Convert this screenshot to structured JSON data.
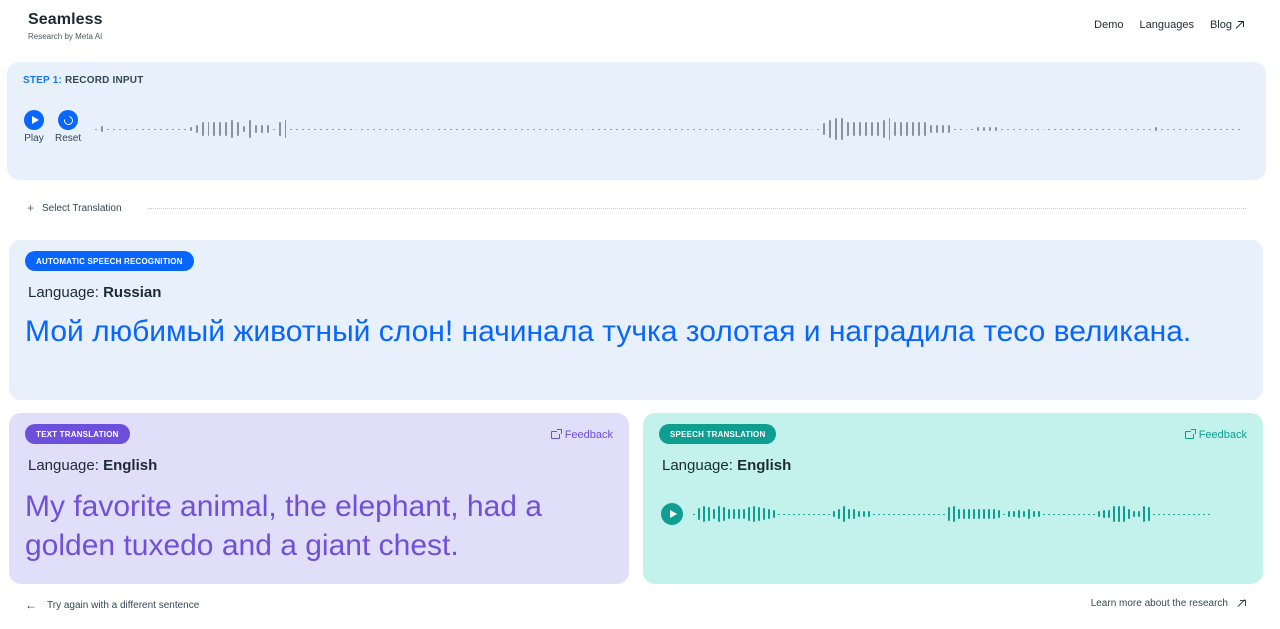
{
  "header": {
    "title": "Seamless",
    "subtitle": "Research by Meta AI",
    "nav": [
      {
        "label": "Demo"
      },
      {
        "label": "Languages"
      },
      {
        "label": "Blog"
      }
    ]
  },
  "step": {
    "prefix": "STEP 1:",
    "label": "RECORD INPUT",
    "play_label": "Play",
    "reset_label": "Reset"
  },
  "select_translation": "Select Translation",
  "asr": {
    "badge": "AUTOMATIC SPEECH RECOGNITION",
    "language_label": "Language:",
    "language": "Russian",
    "text": "Мой любимый животный слон! начинала тучка золотая и наградила тесо великана."
  },
  "text_translation": {
    "badge": "TEXT TRANSLATION",
    "feedback": "Feedback",
    "language_label": "Language:",
    "language": "English",
    "text": "My favorite animal, the elephant, had a golden tuxedo and a giant chest."
  },
  "speech_translation": {
    "badge": "SPEECH TRANSLATION",
    "feedback": "Feedback",
    "language_label": "Language:",
    "language": "English"
  },
  "footer": {
    "left": "Try again with a different sentence",
    "right": "Learn more about the research"
  },
  "colors": {
    "accent_blue": "#0866ff",
    "asr_bg": "#e7f0fb",
    "text_translation_bg": "#e1defa",
    "text_translation_accent": "#7050d6",
    "speech_translation_bg": "#c3f2ec",
    "speech_translation_accent": "#0e9e92"
  },
  "icons": {
    "play": "play-icon",
    "reset": "reset-icon",
    "feedback": "external-feedback-icon",
    "arrow_left": "arrow-left-icon",
    "arrow_out": "arrow-up-right-icon"
  }
}
